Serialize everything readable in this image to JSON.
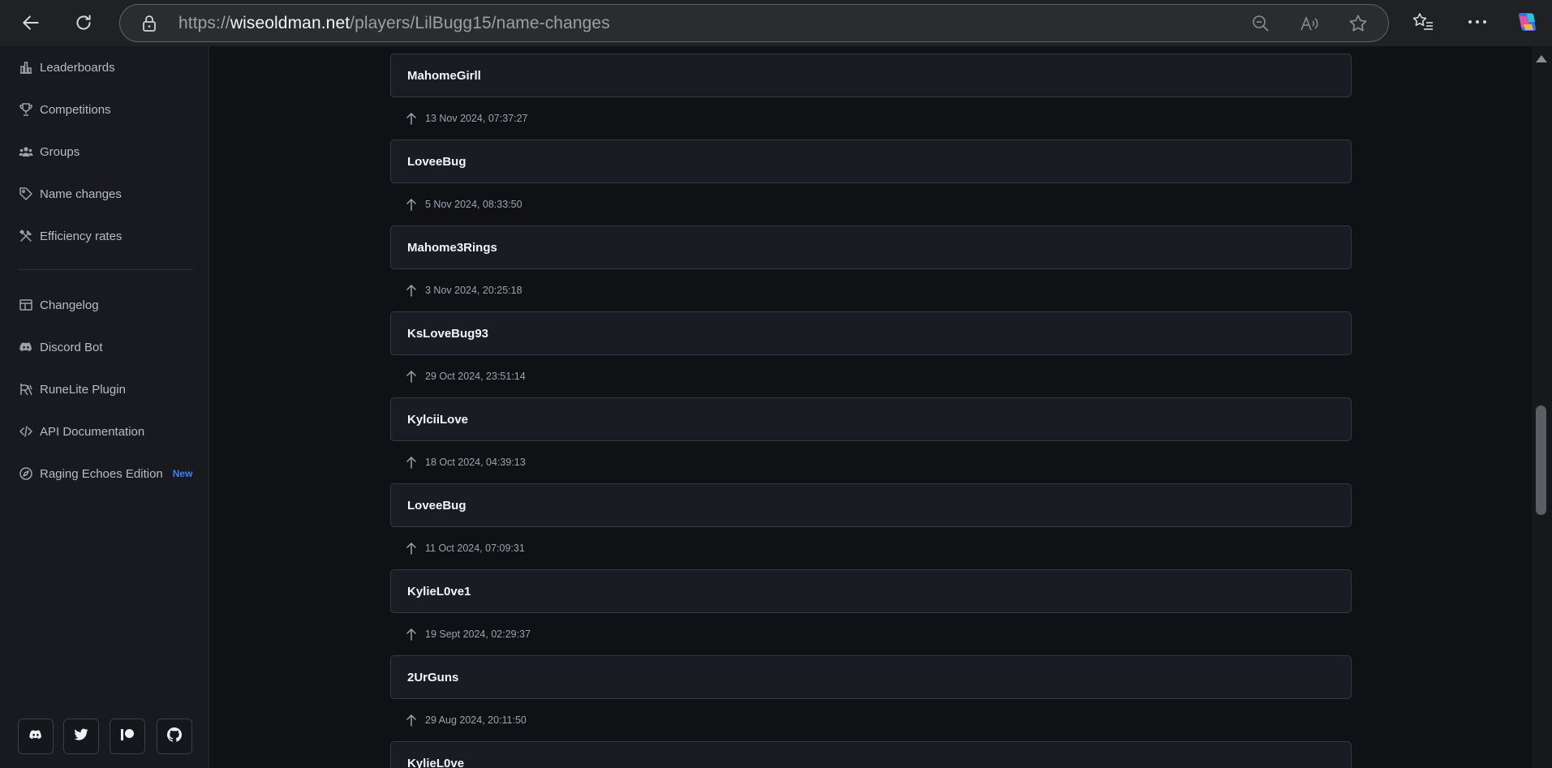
{
  "browser": {
    "url_prefix": "https://",
    "url_host": "wiseoldman.net",
    "url_path": "/players/LilBugg15/name-changes"
  },
  "sidebar": {
    "primary_items": [
      {
        "label": "Leaderboards",
        "icon": "bar-chart-icon"
      },
      {
        "label": "Competitions",
        "icon": "trophy-icon"
      },
      {
        "label": "Groups",
        "icon": "users-icon"
      },
      {
        "label": "Name changes",
        "icon": "tag-icon"
      },
      {
        "label": "Efficiency rates",
        "icon": "tools-icon"
      }
    ],
    "secondary_items": [
      {
        "label": "Changelog",
        "icon": "layout-icon"
      },
      {
        "label": "Discord Bot",
        "icon": "discord-icon"
      },
      {
        "label": "RuneLite Plugin",
        "icon": "runelite-icon"
      },
      {
        "label": "API Documentation",
        "icon": "code-icon"
      },
      {
        "label": "Raging Echoes Edition",
        "icon": "compass-icon",
        "badge": "New"
      }
    ],
    "socials": [
      "discord-icon",
      "twitter-icon",
      "patreon-icon",
      "github-icon"
    ]
  },
  "name_changes": [
    {
      "name": "MahomeGirll",
      "date": "13 Nov 2024, 07:37:27"
    },
    {
      "name": "LoveeBug",
      "date": "5 Nov 2024, 08:33:50"
    },
    {
      "name": "Mahome3Rings",
      "date": "3 Nov 2024, 20:25:18"
    },
    {
      "name": "KsLoveBug93",
      "date": "29 Oct 2024, 23:51:14"
    },
    {
      "name": "KylciiLove",
      "date": "18 Oct 2024, 04:39:13"
    },
    {
      "name": "LoveeBug",
      "date": "11 Oct 2024, 07:09:31"
    },
    {
      "name": "KylieL0ve1",
      "date": "19 Sept 2024, 02:29:37"
    },
    {
      "name": "2UrGuns",
      "date": "29 Aug 2024, 20:11:50"
    },
    {
      "name": "KylieL0ve",
      "date": ""
    }
  ],
  "colors": {
    "accent_badge": "#3b82f6",
    "card_bg": "#1a1c23",
    "page_bg": "#0f1115"
  }
}
